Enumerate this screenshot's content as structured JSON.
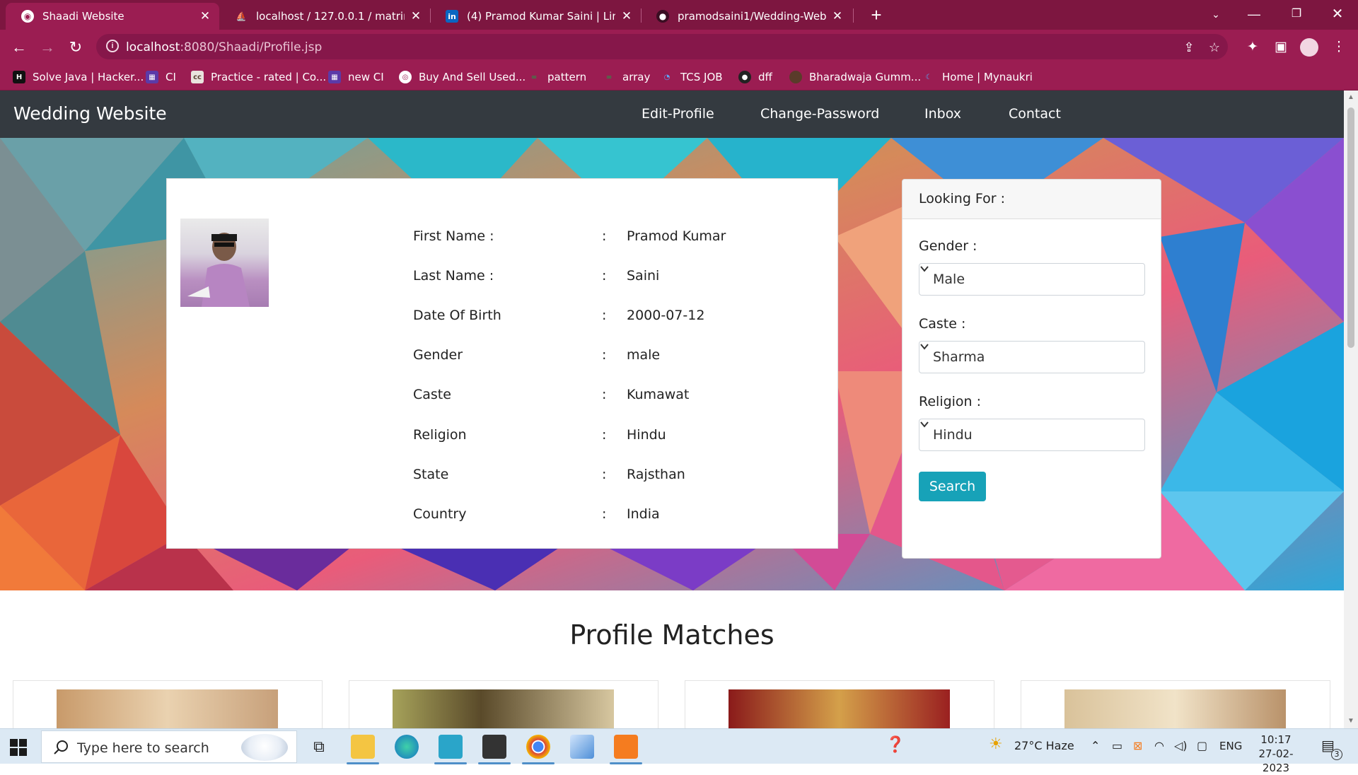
{
  "browser": {
    "tabs": [
      {
        "label": "Shaadi Website",
        "active": true
      },
      {
        "label": "localhost / 127.0.0.1 / matrimoni",
        "active": false
      },
      {
        "label": "(4) Pramod Kumar Saini | LinkedIn",
        "active": false
      },
      {
        "label": "pramodsaini1/Wedding-Website",
        "active": false
      }
    ],
    "url_host": "localhost",
    "url_path": ":8080/Shaadi/Profile.jsp",
    "bookmarks": [
      "Solve Java | Hacker...",
      "CI",
      "Practice - rated | Co...",
      "new CI",
      "Buy And Sell Used...",
      "pattern",
      "array",
      "TCS JOB",
      "dff",
      "Bharadwaja Gumm...",
      "Home | Mynaukri"
    ]
  },
  "site": {
    "brand": "Wedding Website",
    "nav": [
      "Edit-Profile",
      "Change-Password",
      "Inbox",
      "Contact"
    ]
  },
  "profile": {
    "rows": [
      {
        "label": "First Name :",
        "value": "Pramod Kumar"
      },
      {
        "label": "Last Name :",
        "value": "Saini"
      },
      {
        "label": "Date Of Birth",
        "value": "2000-07-12"
      },
      {
        "label": "Gender",
        "value": "male"
      },
      {
        "label": "Caste",
        "value": "Kumawat"
      },
      {
        "label": "Religion",
        "value": "Hindu"
      },
      {
        "label": "State",
        "value": "Rajsthan"
      },
      {
        "label": "Country",
        "value": "India"
      }
    ],
    "separator": ":"
  },
  "looking_for": {
    "title": "Looking For :",
    "gender_label": "Gender :",
    "gender_value": "Male",
    "caste_label": "Caste :",
    "caste_value": "Sharma",
    "religion_label": "Religion :",
    "religion_value": "Hindu",
    "search_label": "Search"
  },
  "matches": {
    "title": "Profile Matches"
  },
  "taskbar": {
    "search_placeholder": "Type here to search",
    "weather": "27°C  Haze",
    "language": "ENG",
    "time": "10:17",
    "date": "27-02-2023",
    "notification_count": "3"
  },
  "colors": {
    "browser_frame": "#7d1640",
    "navbar": "#343a40",
    "search_button": "#17a2b8"
  }
}
